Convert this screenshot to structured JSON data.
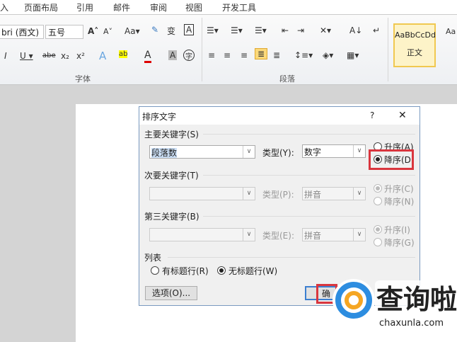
{
  "tabs": [
    "入",
    "页面布局",
    "引用",
    "邮件",
    "审阅",
    "视图",
    "开发工具"
  ],
  "ribbon": {
    "font_name": "bri (西文)",
    "font_size": "五号",
    "font_group": "字体",
    "paragraph_group": "段落",
    "style_preview": "AaBbCcDd",
    "style_name": "正文",
    "style_preview2": "Aa"
  },
  "dialog": {
    "title": "排序文字",
    "help": "?",
    "close": "✕",
    "primary": {
      "label": "主要关键字(S)",
      "value": "段落数",
      "type_label": "类型(Y):",
      "type_value": "数字",
      "asc": "升序(A)",
      "desc": "降序(D)",
      "selected": "desc"
    },
    "secondary": {
      "label": "次要关键字(T)",
      "value": "",
      "type_label": "类型(P):",
      "type_value": "拼音",
      "asc": "升序(C)",
      "desc": "降序(N)",
      "selected": "asc"
    },
    "tertiary": {
      "label": "第三关键字(B)",
      "value": "",
      "type_label": "类型(E):",
      "type_value": "拼音",
      "asc": "升序(I)",
      "desc": "降序(G)",
      "selected": "asc"
    },
    "list": {
      "label": "列表",
      "header": "有标题行(R)",
      "no_header": "无标题行(W)",
      "selected": "no_header"
    },
    "options": "选项(O)...",
    "ok": "确"
  },
  "watermark": {
    "name": "查询啦",
    "url": "chaxunla.com"
  }
}
